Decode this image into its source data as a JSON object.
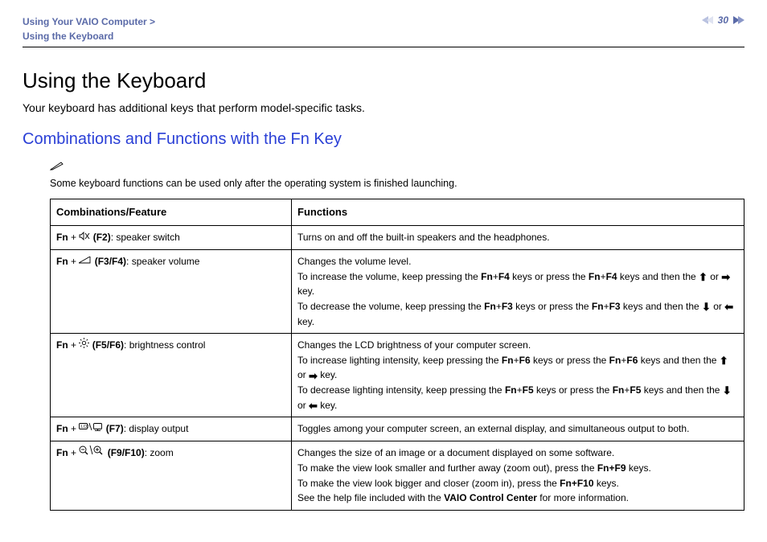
{
  "header": {
    "breadcrumb_line1": "Using Your VAIO Computer >",
    "breadcrumb_line2": "Using the Keyboard",
    "page_number": "30"
  },
  "title": "Using the Keyboard",
  "intro": "Your keyboard has additional keys that perform model-specific tasks.",
  "section_heading": "Combinations and Functions with the Fn Key",
  "note": "Some keyboard functions can be used only after the operating system is finished launching.",
  "table": {
    "header_col1": "Combinations/Feature",
    "header_col2": "Functions",
    "rows": [
      {
        "fn": "Fn",
        "plus": " + ",
        "key": "(F2)",
        "label": ": speaker switch",
        "icon": "speaker-mute-icon",
        "func_plain": "Turns on and off the built-in speakers and the headphones."
      },
      {
        "fn": "Fn",
        "plus": " + ",
        "key": "(F3/F4)",
        "label": ": speaker volume",
        "icon": "volume-icon",
        "f_line1": "Changes the volume level.",
        "f_line2a": "To increase the volume, keep pressing the ",
        "f_line2b": "Fn",
        "f_line2c": "+",
        "f_line2d": "F4",
        "f_line2e": " keys or press the ",
        "f_line2f": "Fn",
        "f_line2g": "+",
        "f_line2h": "F4",
        "f_line2i": " keys and then the ",
        "f_line2j": " or ",
        "f_line2k": " key.",
        "f_line3a": "To decrease the volume, keep pressing the ",
        "f_line3b": "Fn",
        "f_line3c": "+",
        "f_line3d": "F3",
        "f_line3e": " keys or press the ",
        "f_line3f": "Fn",
        "f_line3g": "+",
        "f_line3h": "F3",
        "f_line3i": " keys and then the ",
        "f_line3j": " or ",
        "f_line3k": " key."
      },
      {
        "fn": "Fn",
        "plus": " + ",
        "key": "(F5/F6)",
        "label": ": brightness control",
        "icon": "brightness-icon",
        "f_line1": "Changes the LCD brightness of your computer screen.",
        "f_line2a": "To increase lighting intensity, keep pressing the ",
        "f_line2b": "Fn",
        "f_line2c": "+",
        "f_line2d": "F6",
        "f_line2e": " keys or press the ",
        "f_line2f": "Fn",
        "f_line2g": "+",
        "f_line2h": "F6",
        "f_line2i": " keys and then the ",
        "f_line2j": " or ",
        "f_line2k": " key.",
        "f_line3a": "To decrease lighting intensity, keep pressing the ",
        "f_line3b": "Fn",
        "f_line3c": "+",
        "f_line3d": "F5",
        "f_line3e": " keys or press the ",
        "f_line3f": "Fn",
        "f_line3g": "+",
        "f_line3h": "F5",
        "f_line3i": " keys and then the ",
        "f_line3j": " or ",
        "f_line3k": " key."
      },
      {
        "fn": "Fn",
        "plus": " + ",
        "key": "(F7)",
        "label": ": display output",
        "icon": "display-output-icon",
        "func_plain": "Toggles among your computer screen, an external display, and simultaneous output to both."
      },
      {
        "fn": "Fn",
        "plus": " + ",
        "key": "(F9/F10)",
        "label": ": zoom",
        "icon": "zoom-icon",
        "f_line1": "Changes the size of an image or a document displayed on some software.",
        "f_line2a": "To make the view look smaller and further away (zoom out), press the ",
        "f_line2b": "Fn+F9",
        "f_line2c": " keys.",
        "f_line3a": "To make the view look bigger and closer (zoom in), press the ",
        "f_line3b": "Fn+F10",
        "f_line3c": " keys.",
        "f_line4a": "See the help file included with the ",
        "f_line4b": "VAIO Control Center",
        "f_line4c": " for more information."
      }
    ]
  }
}
